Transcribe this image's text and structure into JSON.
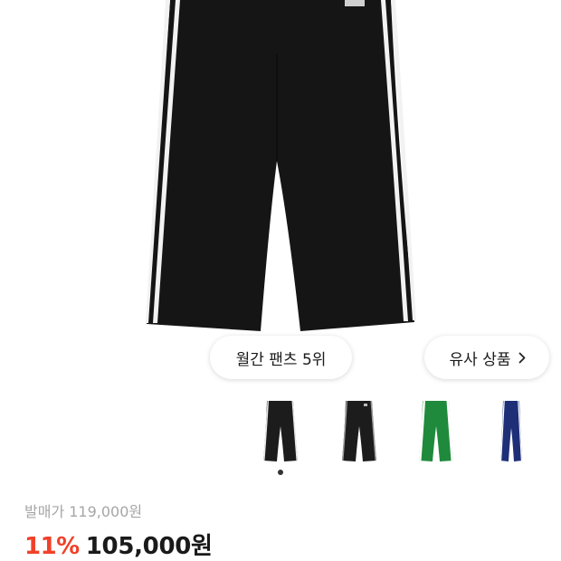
{
  "gallery": {
    "main_image": "black-track-pants",
    "rank_badge": "월간 팬츠 5위",
    "similar_button": "유사 상품",
    "thumbnails": [
      {
        "product": "black-track-pants-white-stripes",
        "color": "#1c1c1c",
        "stripe": "#e8e8e8",
        "selected": true
      },
      {
        "product": "black-track-pants-grey-stripes",
        "color": "#1c1c1c",
        "stripe": "#9a9a9a",
        "selected": false
      },
      {
        "product": "green-track-pants-white-stripes",
        "color": "#1f8a3c",
        "stripe": "#ffffff",
        "selected": false
      },
      {
        "product": "navy-track-pants-white-stripes",
        "color": "#1e2f78",
        "stripe": "#ffffff",
        "selected": false
      }
    ]
  },
  "price": {
    "list_price": "발매가 119,000원",
    "discount": "11%",
    "sale_price": "105,000원"
  },
  "colors": {
    "discount": "#f0412a",
    "pants_main": "#151515"
  }
}
